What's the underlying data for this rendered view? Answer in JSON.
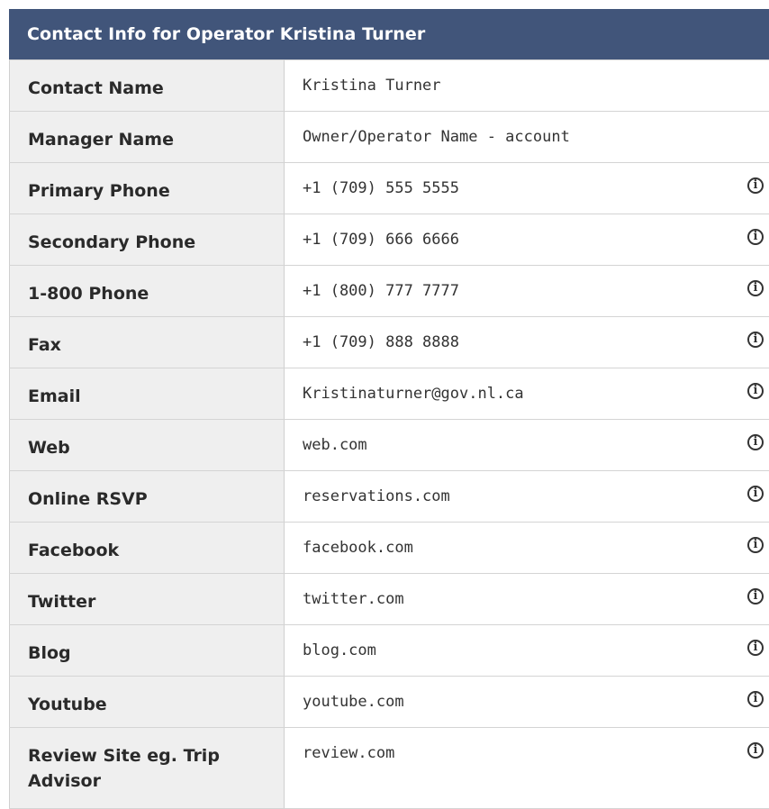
{
  "panel": {
    "title": "Contact Info for Operator Kristina Turner"
  },
  "rows": [
    {
      "label": "Contact Name",
      "value": "Kristina Turner",
      "has_info": false
    },
    {
      "label": "Manager Name",
      "value": "Owner/Operator Name - account",
      "has_info": false
    },
    {
      "label": "Primary Phone",
      "value": "+1 (709) 555 5555",
      "has_info": true
    },
    {
      "label": "Secondary Phone",
      "value": "+1 (709) 666 6666",
      "has_info": true
    },
    {
      "label": "1-800 Phone",
      "value": "+1 (800) 777 7777",
      "has_info": true
    },
    {
      "label": "Fax",
      "value": "+1 (709) 888 8888",
      "has_info": true
    },
    {
      "label": "Email",
      "value": "Kristinaturner@gov.nl.ca",
      "has_info": true
    },
    {
      "label": "Web",
      "value": "web.com",
      "has_info": true
    },
    {
      "label": "Online RSVP",
      "value": "reservations.com",
      "has_info": true
    },
    {
      "label": "Facebook",
      "value": "facebook.com",
      "has_info": true
    },
    {
      "label": "Twitter",
      "value": "twitter.com",
      "has_info": true
    },
    {
      "label": "Blog",
      "value": "blog.com",
      "has_info": true
    },
    {
      "label": "Youtube",
      "value": "youtube.com",
      "has_info": true
    },
    {
      "label": "Review Site eg. Trip Advisor",
      "value": "review.com",
      "has_info": true
    }
  ],
  "icons": {
    "info": "info-icon",
    "glyph": "i"
  },
  "colors": {
    "header_bg": "#41557a",
    "header_text": "#ffffff",
    "label_bg": "#efefef",
    "border": "#d4d4d4"
  }
}
